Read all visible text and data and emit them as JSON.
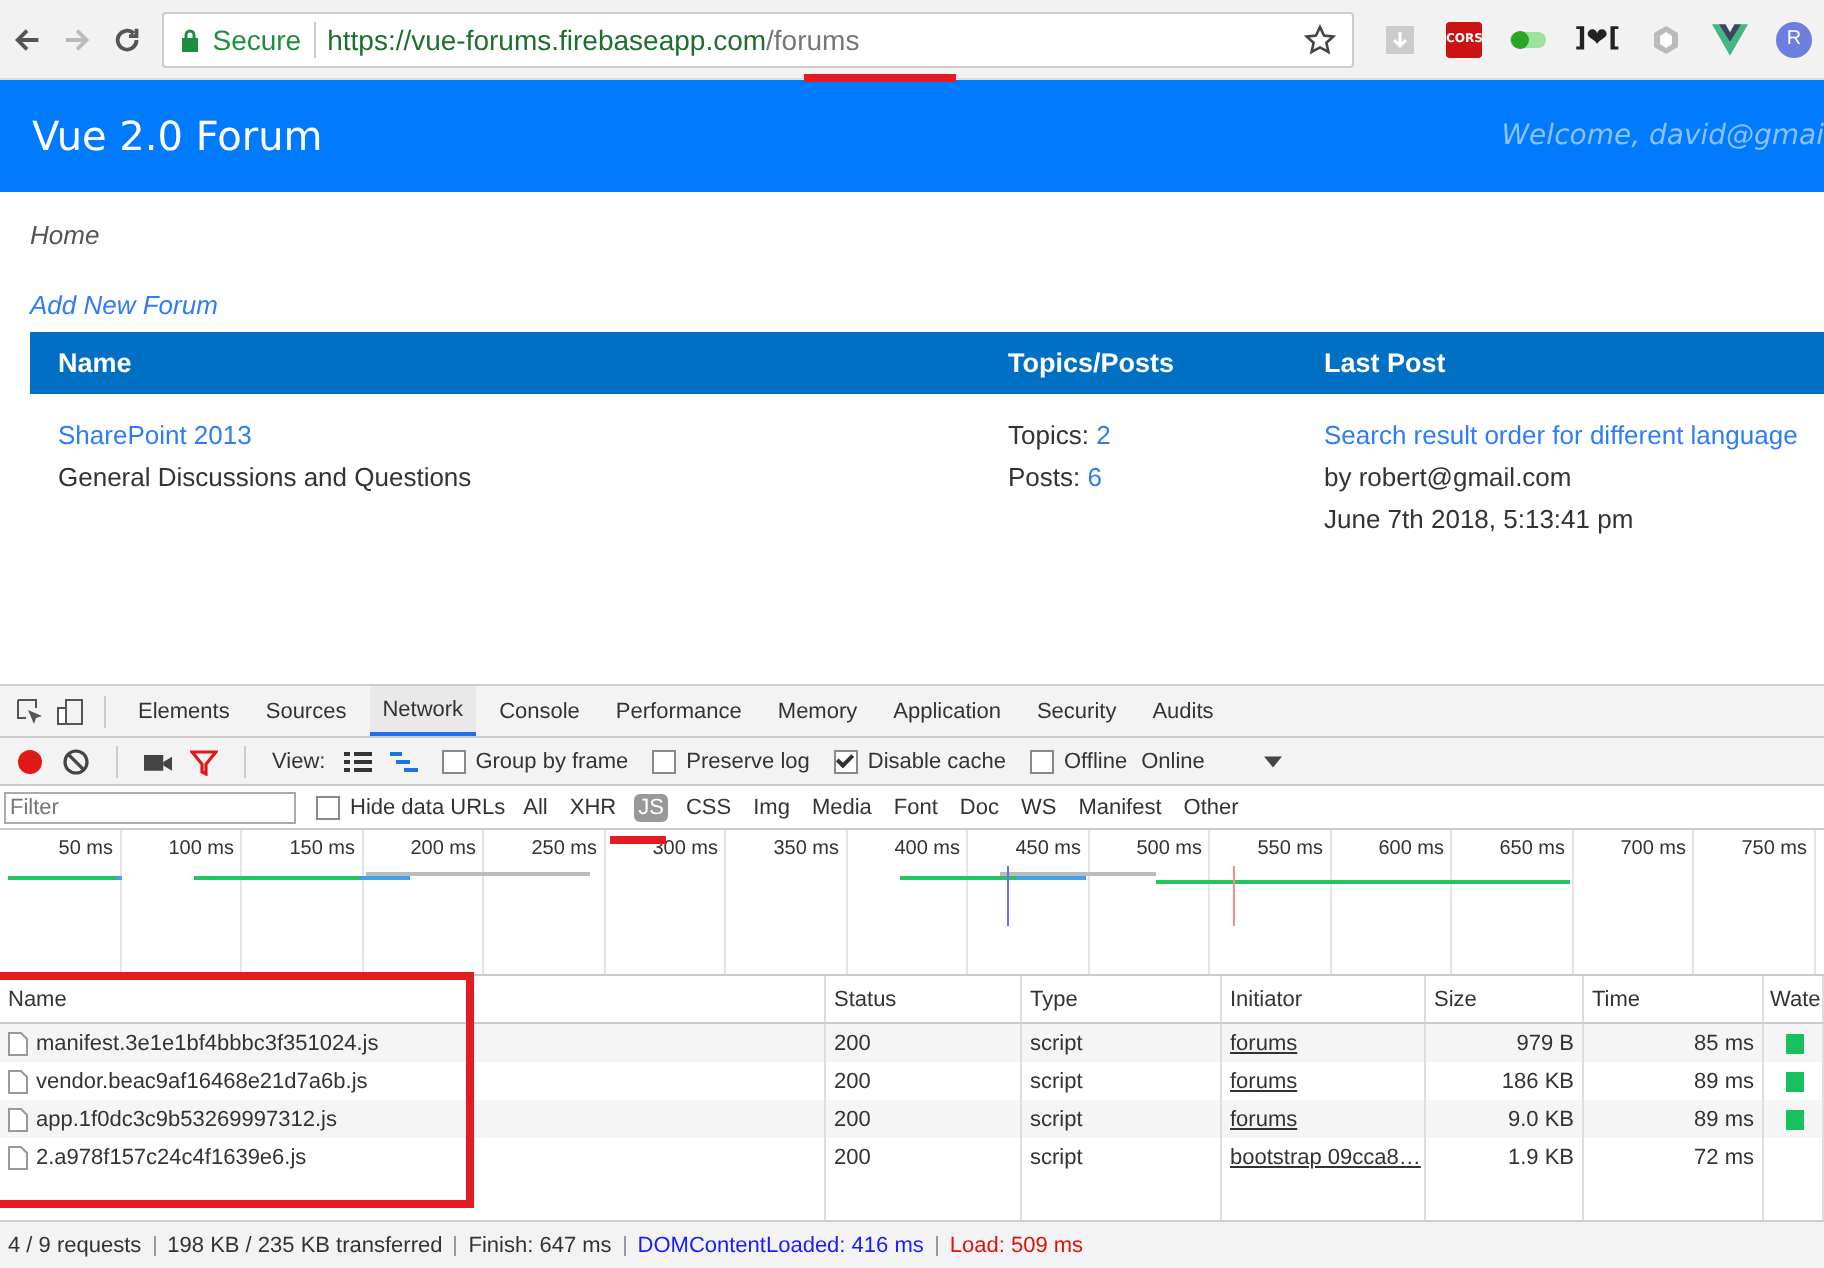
{
  "browser": {
    "secure_label": "Secure",
    "url_host": "https://vue-forums.firebaseapp.com",
    "url_path": "/forums",
    "extensions": [
      {
        "kind": "download"
      },
      {
        "kind": "badge",
        "label": "CORS",
        "color": "#cc1111"
      },
      {
        "kind": "toggle"
      },
      {
        "kind": "text",
        "label": "]❤["
      },
      {
        "kind": "hex"
      },
      {
        "kind": "vue"
      },
      {
        "kind": "round",
        "label": "R",
        "color": "#6c7ee0"
      }
    ]
  },
  "app": {
    "title": "Vue 2.0 Forum",
    "welcome": "Welcome, david@gmai",
    "breadcrumb": "Home",
    "add_link": "Add New Forum",
    "columns": [
      "Name",
      "Topics/Posts",
      "Last Post"
    ],
    "rows": [
      {
        "forum": "SharePoint 2013",
        "description": "General Discussions and Questions",
        "topics_label": "Topics:",
        "topics": "2",
        "posts_label": "Posts:",
        "posts": "6",
        "last_post": "Search result order for different language",
        "by": "by robert@gmail.com",
        "date": "June 7th 2018, 5:13:41 pm"
      }
    ]
  },
  "devtools": {
    "tabs": [
      {
        "label": "Elements",
        "selected": false
      },
      {
        "label": "Sources",
        "selected": false
      },
      {
        "label": "Network",
        "selected": true
      },
      {
        "label": "Console",
        "selected": false
      },
      {
        "label": "Performance",
        "selected": false
      },
      {
        "label": "Memory",
        "selected": false
      },
      {
        "label": "Application",
        "selected": false
      },
      {
        "label": "Security",
        "selected": false
      },
      {
        "label": "Audits",
        "selected": false
      }
    ],
    "recording": true,
    "view_label": "View:",
    "options": [
      {
        "label": "Group by frame",
        "checked": false
      },
      {
        "label": "Preserve log",
        "checked": false
      },
      {
        "label": "Disable cache",
        "checked": true
      },
      {
        "label": "Offline",
        "checked": false
      }
    ],
    "throttle": "Online",
    "filter_placeholder": "Filter",
    "hide_data_urls": {
      "label": "Hide data URLs",
      "checked": false
    },
    "type_filters": [
      {
        "label": "All",
        "selected": false
      },
      {
        "label": "XHR",
        "selected": false
      },
      {
        "label": "JS",
        "selected": true
      },
      {
        "label": "CSS",
        "selected": false
      },
      {
        "label": "Img",
        "selected": false
      },
      {
        "label": "Media",
        "selected": false
      },
      {
        "label": "Font",
        "selected": false
      },
      {
        "label": "Doc",
        "selected": false
      },
      {
        "label": "WS",
        "selected": false
      },
      {
        "label": "Manifest",
        "selected": false
      },
      {
        "label": "Other",
        "selected": false
      }
    ],
    "ticks": [
      "50 ms",
      "100 ms",
      "150 ms",
      "200 ms",
      "250 ms",
      "300 ms",
      "350 ms",
      "400 ms",
      "450 ms",
      "500 ms",
      "550 ms",
      "600 ms",
      "650 ms",
      "700 ms",
      "750 ms"
    ],
    "columns": [
      "Name",
      "Status",
      "Type",
      "Initiator",
      "Size",
      "Time",
      "Wate"
    ],
    "requests": [
      {
        "name": "manifest.3e1e1bf4bbbc3f351024.js",
        "status": "200",
        "type": "script",
        "initiator": "forums",
        "size": "979 B",
        "time": "85 ms",
        "bar": true
      },
      {
        "name": "vendor.beac9af16468e21d7a6b.js",
        "status": "200",
        "type": "script",
        "initiator": "forums",
        "size": "186 KB",
        "time": "89 ms",
        "bar": true
      },
      {
        "name": "app.1f0dc3c9b53269997312.js",
        "status": "200",
        "type": "script",
        "initiator": "forums",
        "size": "9.0 KB",
        "time": "89 ms",
        "bar": true
      },
      {
        "name": "2.a978f157c24c4f1639e6.js",
        "status": "200",
        "type": "script",
        "initiator": "bootstrap 09cca8…",
        "size": "1.9 KB",
        "time": "72 ms",
        "bar": false
      }
    ],
    "status_bar": [
      {
        "kind": "plain",
        "text": "4 / 9 requests"
      },
      {
        "kind": "plain",
        "text": "198 KB / 235 KB transferred"
      },
      {
        "kind": "plain",
        "text": "Finish: 647 ms"
      },
      {
        "kind": "dom",
        "text": "DOMContentLoaded: 416 ms"
      },
      {
        "kind": "load",
        "text": "Load: 509 ms"
      }
    ]
  }
}
